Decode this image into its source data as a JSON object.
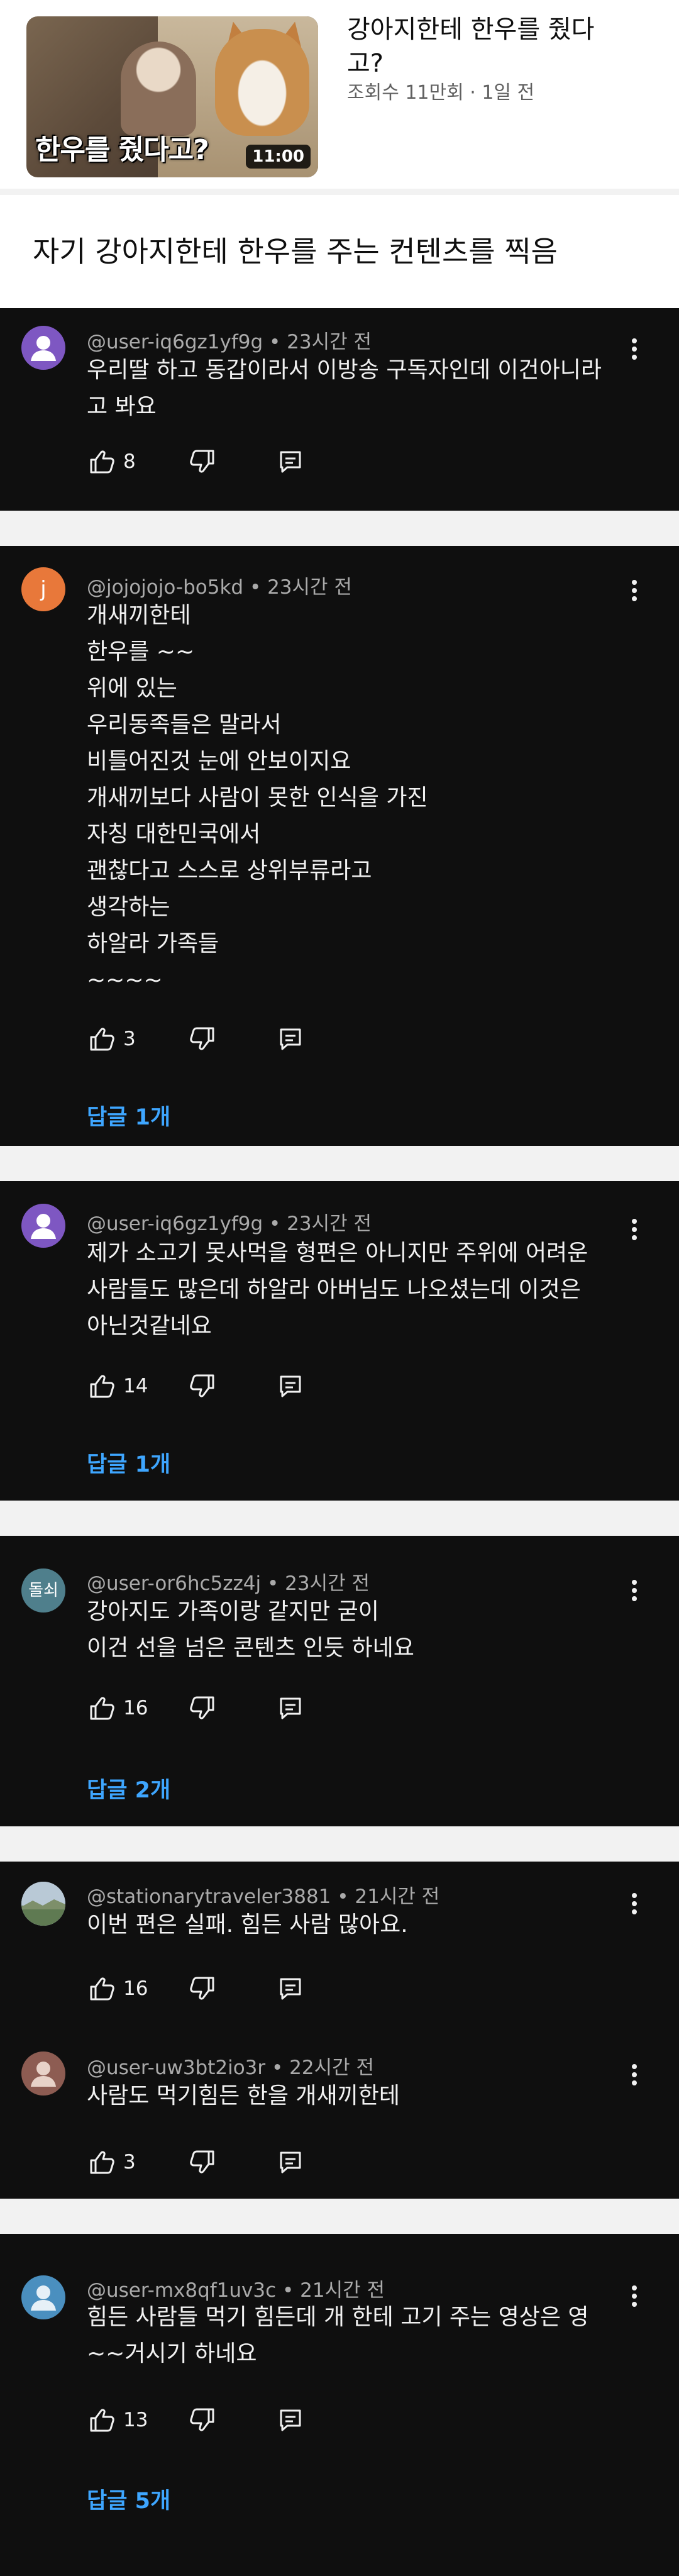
{
  "video": {
    "title_line1": "강아지한테 한우를 줬다",
    "title_line2": "고?",
    "meta": "조회수 11만회 · 1일 전",
    "thumbnail_caption": "한우를 줬다고?",
    "duration": "11:00"
  },
  "user_caption": "자기 강아지한테 한우를 주는 컨텐츠를 찍음",
  "colors": {
    "background_dark": "#0f0f0f",
    "text_primary": "#f1f1f1",
    "text_secondary": "#aaaaaa",
    "replies_link": "#3ea6ff",
    "separator": "#f2f2f2"
  },
  "comments": [
    {
      "author": "@user-iq6gz1yf9g",
      "time": "23시간 전",
      "avatar_color": "#7e57c2",
      "avatar_icon": "default-user-icon",
      "lines": [
        "우리딸 하고 동갑이라서 이방송 구독자인데 이건아니라",
        "고 봐요"
      ],
      "likes": "8",
      "replies": ""
    },
    {
      "author": "@jojojojo-bo5kd",
      "time": "23시간 전",
      "avatar_color": "#e8783a",
      "avatar_letter": "j",
      "lines": [
        "개새끼한테",
        "한우를 ~~",
        "위에 있는",
        "우리동족들은 말라서",
        "비틀어진것 눈에 안보이지요",
        "개새끼보다 사람이 못한 인식을 가진",
        "자칭 대한민국에서",
        "괜찮다고 스스로 상위부류라고",
        "생각하는",
        "하알라 가족들",
        "~~~~"
      ],
      "likes": "3",
      "replies": "답글 1개"
    },
    {
      "author": "@user-iq6gz1yf9g",
      "time": "23시간 전",
      "avatar_color": "#7e57c2",
      "avatar_icon": "default-user-icon",
      "lines": [
        "제가 소고기 못사먹을 형편은 아니지만 주위에 어려운",
        "사람들도 많은데 하알라  아버님도 나오셨는데 이것은",
        "아닌것같네요"
      ],
      "likes": "14",
      "replies": "답글 1개"
    },
    {
      "author": "@user-or6hc5zz4j",
      "time": "23시간 전",
      "avatar_color": "#4f7f8c",
      "avatar_letter": "돌쇠",
      "lines": [
        "강아지도 가족이랑 같지만 굳이",
        "이건 선을 넘은 콘텐츠 인듯 하네요"
      ],
      "likes": "16",
      "replies": "답글 2개"
    },
    {
      "author": "@stationarytraveler3881",
      "time": "21시간 전",
      "avatar_color": "#8aa0b4",
      "avatar_icon": "landscape-photo-icon",
      "lines": [
        "이번 편은 실패. 힘든 사람 많아요."
      ],
      "likes": "16",
      "replies": ""
    },
    {
      "author": "@user-uw3bt2io3r",
      "time": "22시간 전",
      "avatar_color": "#8d5c52",
      "avatar_icon": "default-user-icon",
      "lines": [
        "사람도 먹기힘든 한을 개새끼한테"
      ],
      "likes": "3",
      "replies": ""
    },
    {
      "author": "@user-mx8qf1uv3c",
      "time": "21시간 전",
      "avatar_color": "#4a8fbf",
      "avatar_icon": "default-user-icon",
      "lines": [
        "힘든 사람들 먹기 힘든데 개 한테 고기 주는 영상은 영",
        "~~거시기 하네요"
      ],
      "likes": "13",
      "replies": "답글 5개"
    }
  ],
  "icons": {
    "like": "thumbs-up-icon",
    "dislike": "thumbs-down-icon",
    "reply": "reply-comment-icon",
    "more": "more-vertical-icon"
  }
}
